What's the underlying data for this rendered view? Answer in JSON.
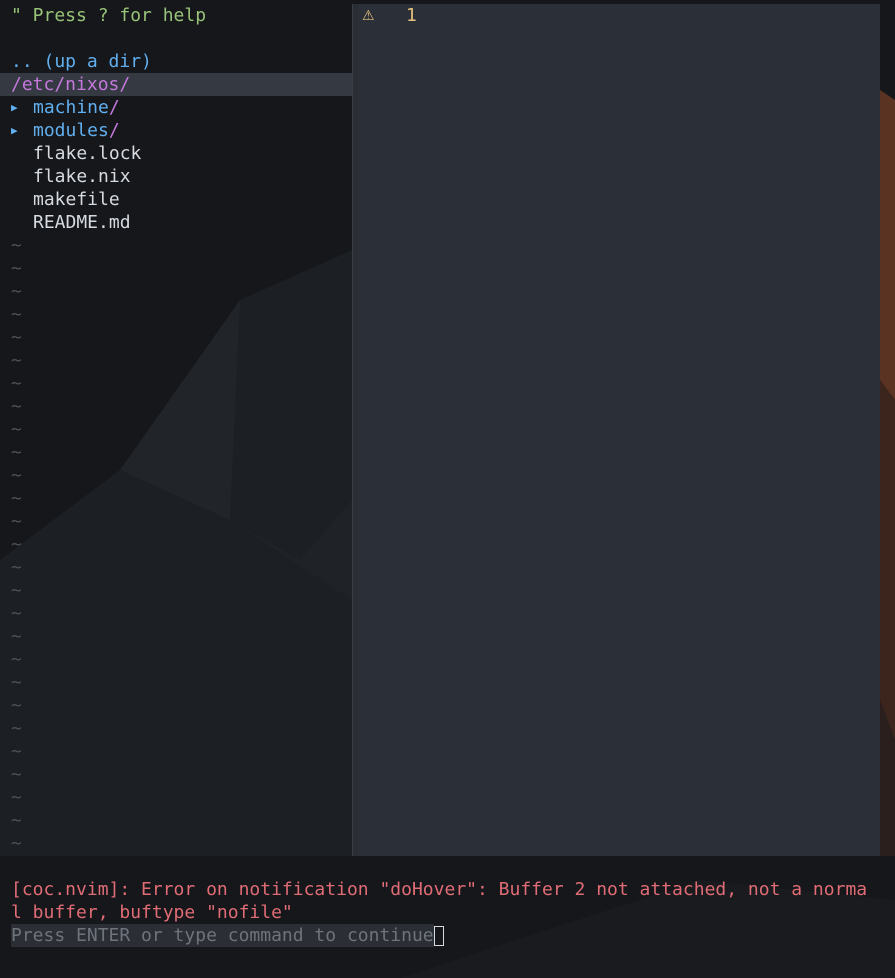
{
  "colors": {
    "accent_dir": "#61afef",
    "dir_slash": "#c678dd",
    "help_text": "#98c379",
    "error": "#e06c75",
    "warning_sign": "#e5c07b",
    "editor_bg": "#2b3038"
  },
  "nerdtree": {
    "help_hint": "\" Press ? for help",
    "up_dir": ".. (up a dir)",
    "current_dir": "/etc/nixos/",
    "directories": [
      {
        "name": "machine",
        "slash": "/",
        "icon": "triangle-right-icon"
      },
      {
        "name": "modules",
        "slash": "/",
        "icon": "triangle-right-icon"
      }
    ],
    "files": [
      "flake.lock",
      "flake.nix",
      "makefile",
      "README.md"
    ],
    "empty_line_marker": "~"
  },
  "editor": {
    "sign_icon": "warning-icon",
    "sign_glyph": "⚠",
    "line_number": "1"
  },
  "messages": {
    "error_line_1": "[coc.nvim]: Error on notification \"doHover\": Buffer 2 not attached, not a norma",
    "error_line_2": "l buffer, buftype \"nofile\"",
    "prompt": "Press ENTER or type command to continue"
  }
}
